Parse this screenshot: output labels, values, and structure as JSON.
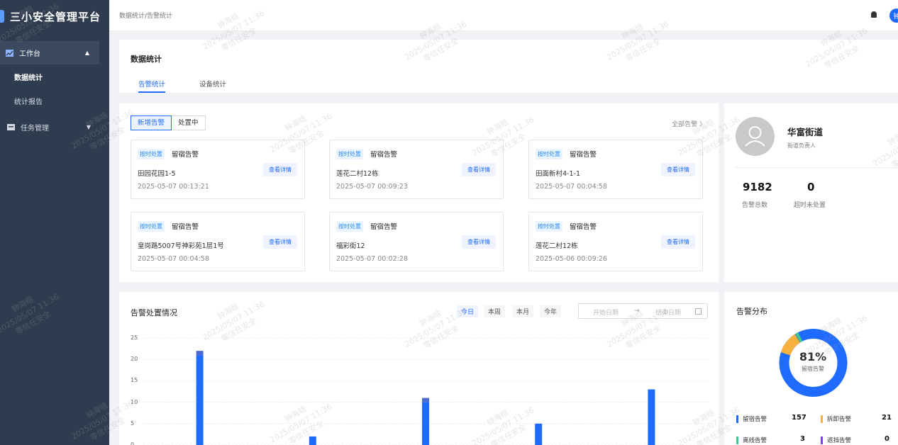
{
  "app_title": "三小安全管理平台",
  "colors": {
    "accent": "#1f6bff",
    "sidebar": "#2f3c4f",
    "orange": "#f5b03e",
    "green": "#3dc98b",
    "purple": "#7d3cff"
  },
  "sidebar": {
    "group": {
      "label": "工作台",
      "icon": "dashboard-icon"
    },
    "sub_items": [
      {
        "label": "数据统计"
      },
      {
        "label": "统计报告"
      }
    ],
    "task": {
      "label": "任务管理",
      "icon": "folder-icon"
    }
  },
  "breadcrumb": "数据统计/告警统计",
  "user_initial": "钟",
  "page": {
    "title": "数据统计",
    "tabs": [
      "告警统计",
      "设备统计"
    ]
  },
  "alerts": {
    "filters": [
      "新增告警",
      "处置中"
    ],
    "all_link": "全部告警 〉",
    "cards": [
      {
        "tag": "按时处置",
        "type": "留宿告警",
        "address": "田园花园1-5",
        "time": "2025-05-07 00:13:21",
        "button": "查看详情"
      },
      {
        "tag": "按时处置",
        "type": "留宿告警",
        "address": "莲花二村12栋",
        "time": "2025-05-07 00:09:23",
        "button": "查看详情"
      },
      {
        "tag": "按时处置",
        "type": "留宿告警",
        "address": "田面新村4-1-1",
        "time": "2025-05-07 00:04:58",
        "button": "查看详情"
      },
      {
        "tag": "按时处置",
        "type": "留宿告警",
        "address": "皇岗路5007号神彩苑1层1号",
        "time": "2025-05-07 00:04:58",
        "button": "查看详情"
      },
      {
        "tag": "按时处置",
        "type": "留宿告警",
        "address": "福彩街12",
        "time": "2025-05-07 00:02:28",
        "button": "查看详情"
      },
      {
        "tag": "按时处置",
        "type": "留宿告警",
        "address": "莲花二村12栋",
        "time": "2025-05-06 00:09:26",
        "button": "查看详情"
      }
    ]
  },
  "profile": {
    "name": "华富街道",
    "role": "街道负责人",
    "stats": [
      {
        "value": "9182",
        "label": "告警总数"
      },
      {
        "value": "0",
        "label": "超时未处置"
      }
    ]
  },
  "chart_panel": {
    "title": "告警处置情况",
    "ranges": [
      "今日",
      "本周",
      "本月",
      "今年"
    ],
    "date_start": "开始日期",
    "date_arrow": "→",
    "date_end": "结束日期"
  },
  "chart_data": {
    "type": "bar",
    "title": "告警处置情况",
    "yticks": [
      25,
      20,
      15,
      10,
      5,
      0
    ],
    "ylim": [
      0,
      25
    ],
    "series": [
      {
        "values": [
          21,
          2,
          10,
          5,
          13
        ],
        "color": "#1f6bff"
      },
      {
        "values": [
          1,
          0,
          1,
          0,
          0
        ],
        "color": "#4a6bd6"
      }
    ]
  },
  "distribution": {
    "title": "告警分布",
    "center_pct": "81%",
    "center_label": "留宿告警",
    "legend": [
      {
        "label": "留宿告警",
        "value": "157",
        "color": "#1f6bff"
      },
      {
        "label": "拆卸告警",
        "value": "21",
        "color": "#f5b03e"
      },
      {
        "label": "离线告警",
        "value": "3",
        "color": "#3dc98b"
      },
      {
        "label": "遮挡告警",
        "value": "0",
        "color": "#7d3cff"
      }
    ]
  },
  "watermark": [
    "钟海晗",
    "2025/05/07 11:36",
    "零信任安全"
  ]
}
